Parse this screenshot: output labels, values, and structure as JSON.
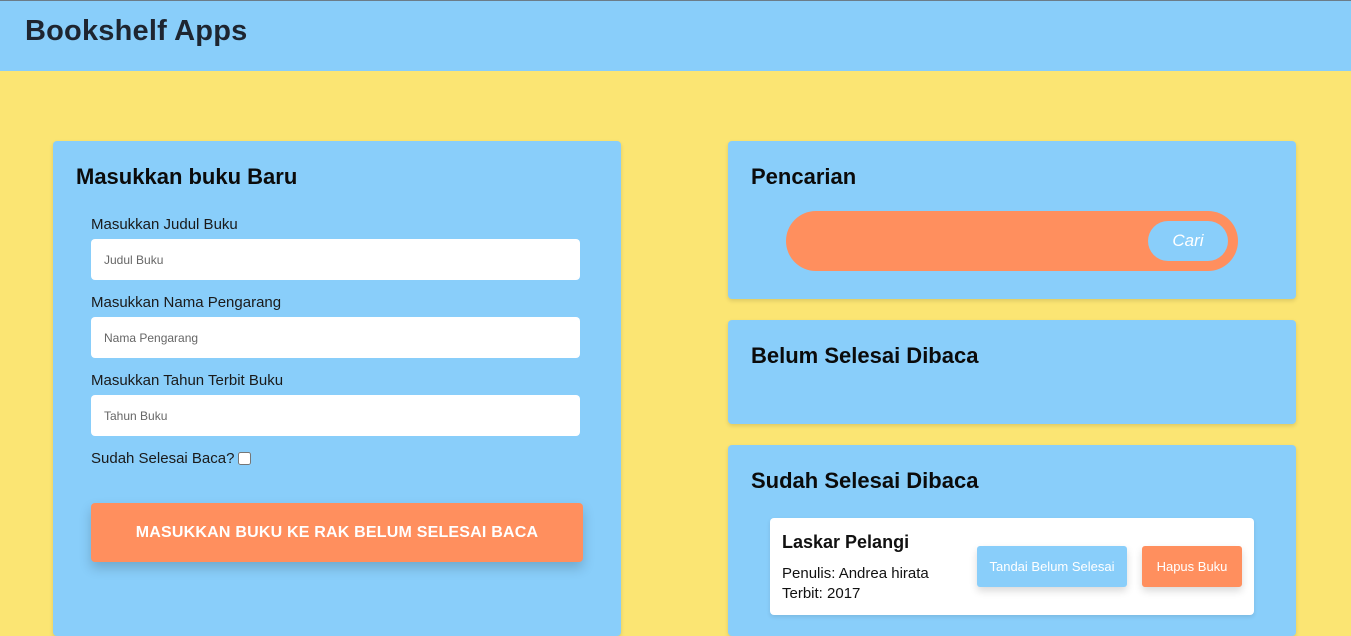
{
  "header": {
    "title": "Bookshelf Apps"
  },
  "form": {
    "heading": "Masukkan buku Baru",
    "title_label": "Masukkan Judul Buku",
    "title_placeholder": "Judul Buku",
    "author_label": "Masukkan Nama Pengarang",
    "author_placeholder": "Nama Pengarang",
    "year_label": "Masukkan Tahun Terbit Buku",
    "year_placeholder": "Tahun Buku",
    "complete_label": "Sudah Selesai Baca?",
    "submit_label": "MASUKKAN BUKU KE RAK BELUM SELESAI BACA"
  },
  "search": {
    "heading": "Pencarian",
    "input_value": "",
    "button_label": "Cari"
  },
  "unread": {
    "heading": "Belum Selesai Dibaca"
  },
  "read": {
    "heading": "Sudah Selesai Dibaca",
    "books": [
      {
        "title": "Laskar Pelangi",
        "author": "Penulis: Andrea hirata",
        "year": "Terbit: 2017",
        "unfinish_label": "Tandai Belum Selesai",
        "delete_label": "Hapus Buku"
      }
    ]
  },
  "colors": {
    "header_bg": "#89cefa",
    "page_bg": "#fbe573",
    "accent": "#ff8f5e"
  }
}
